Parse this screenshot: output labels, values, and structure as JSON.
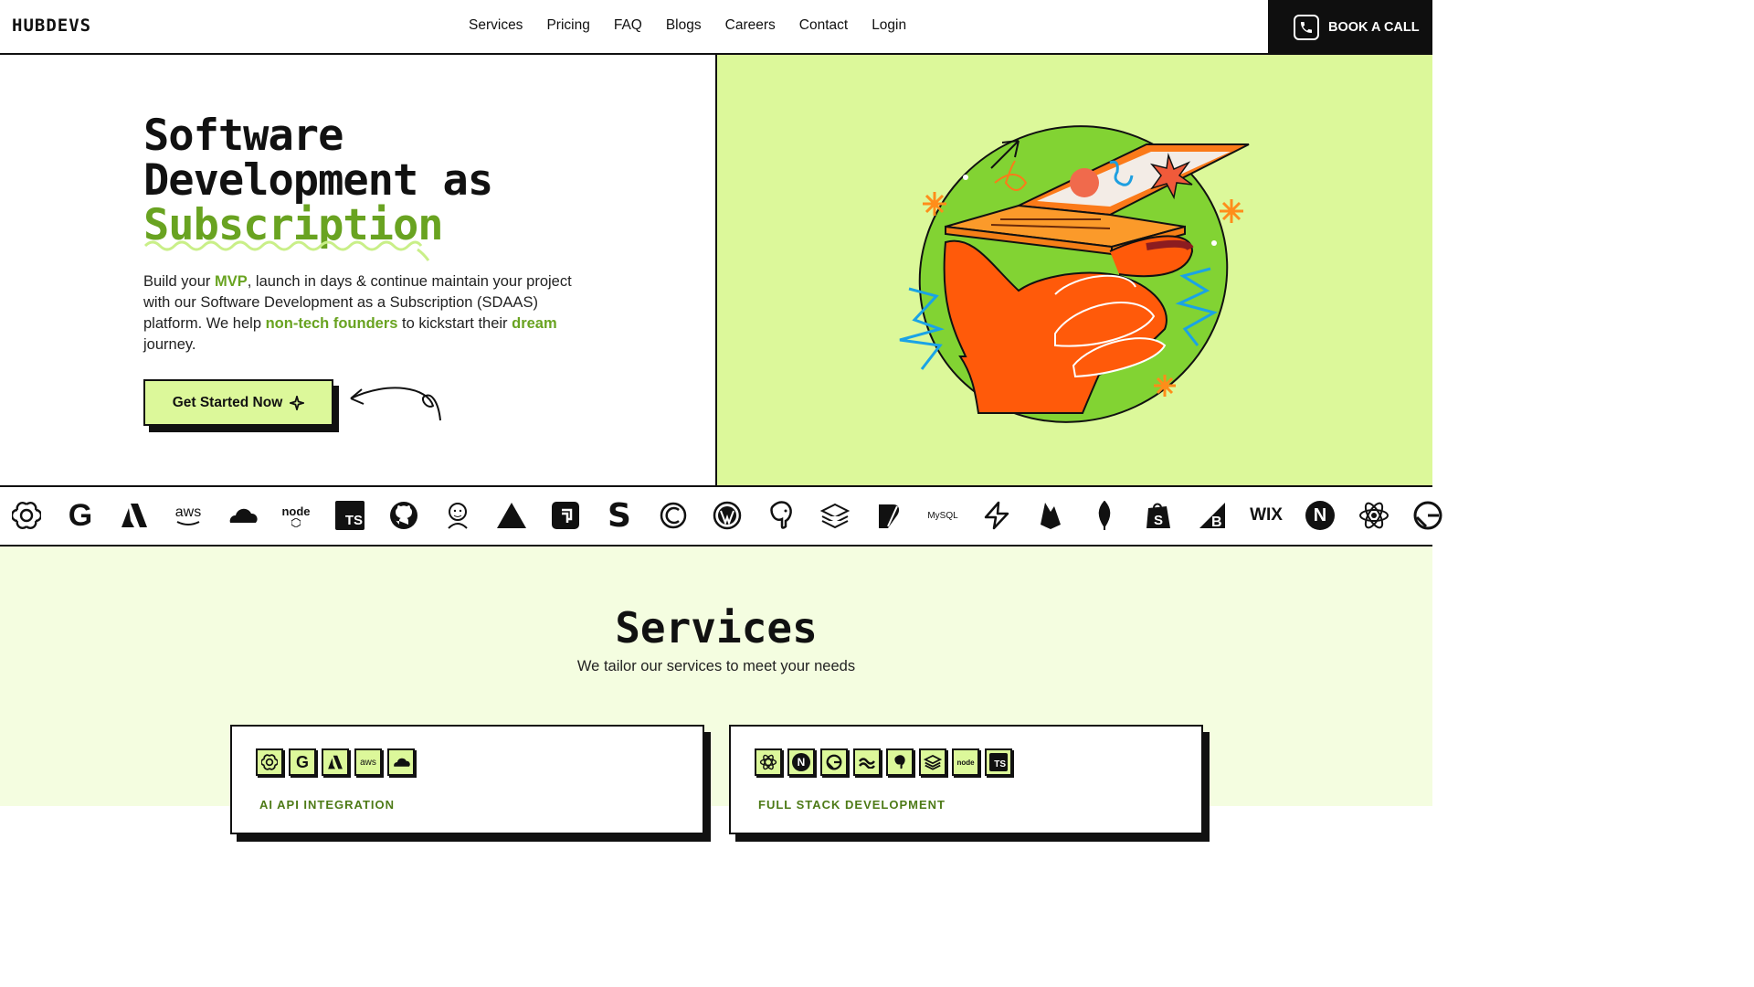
{
  "nav": {
    "logo": "HUBDEVS",
    "items": [
      "Services",
      "Pricing",
      "FAQ",
      "Blogs",
      "Careers",
      "Contact",
      "Login"
    ],
    "book_label": "BOOK A CALL"
  },
  "hero": {
    "title_line1": "Software",
    "title_line2": "Development as",
    "title_line3": "Subscription",
    "desc_1": "Build your ",
    "desc_mvp": "MVP",
    "desc_2": ", launch in days & continue maintain your project with our Software Development as a Subscription (SDAAS) platform. We help ",
    "desc_founders": "non-tech founders",
    "desc_3": " to kickstart their ",
    "desc_dream": "dream",
    "desc_4": " journey.",
    "cta_label": "Get Started Now"
  },
  "tech_logos": [
    "openai",
    "google",
    "azure",
    "aws",
    "cloudflare",
    "node",
    "typescript",
    "github",
    "jenkins",
    "vercel",
    "appwrite",
    "stripe",
    "cypress",
    "wordpress",
    "postgresql",
    "stack",
    "feather",
    "mysql",
    "supabase",
    "firebase",
    "mongodb",
    "shopify",
    "bigcommerce",
    "wix",
    "nextjs",
    "react",
    "gatsby"
  ],
  "tech_text": {
    "aws": "aws",
    "node": "node",
    "ts": "TS",
    "mysql": "MySQL",
    "wix": "WIX",
    "next": "N"
  },
  "services": {
    "title": "Services",
    "subtitle": "We tailor our services to meet your needs",
    "cards": [
      {
        "label": "AI API INTEGRATION",
        "chips": [
          "openai",
          "google",
          "azure",
          "aws",
          "cloudflare"
        ]
      },
      {
        "label": "FULL STACK DEVELOPMENT",
        "chips": [
          "react",
          "nextjs",
          "gatsby",
          "tailwind",
          "postgresql",
          "stack",
          "node",
          "typescript"
        ]
      }
    ]
  },
  "colors": {
    "accent_green": "#69a321",
    "light_green": "#dcf89a",
    "pale_green": "#f4fde0",
    "dark": "#111111"
  }
}
